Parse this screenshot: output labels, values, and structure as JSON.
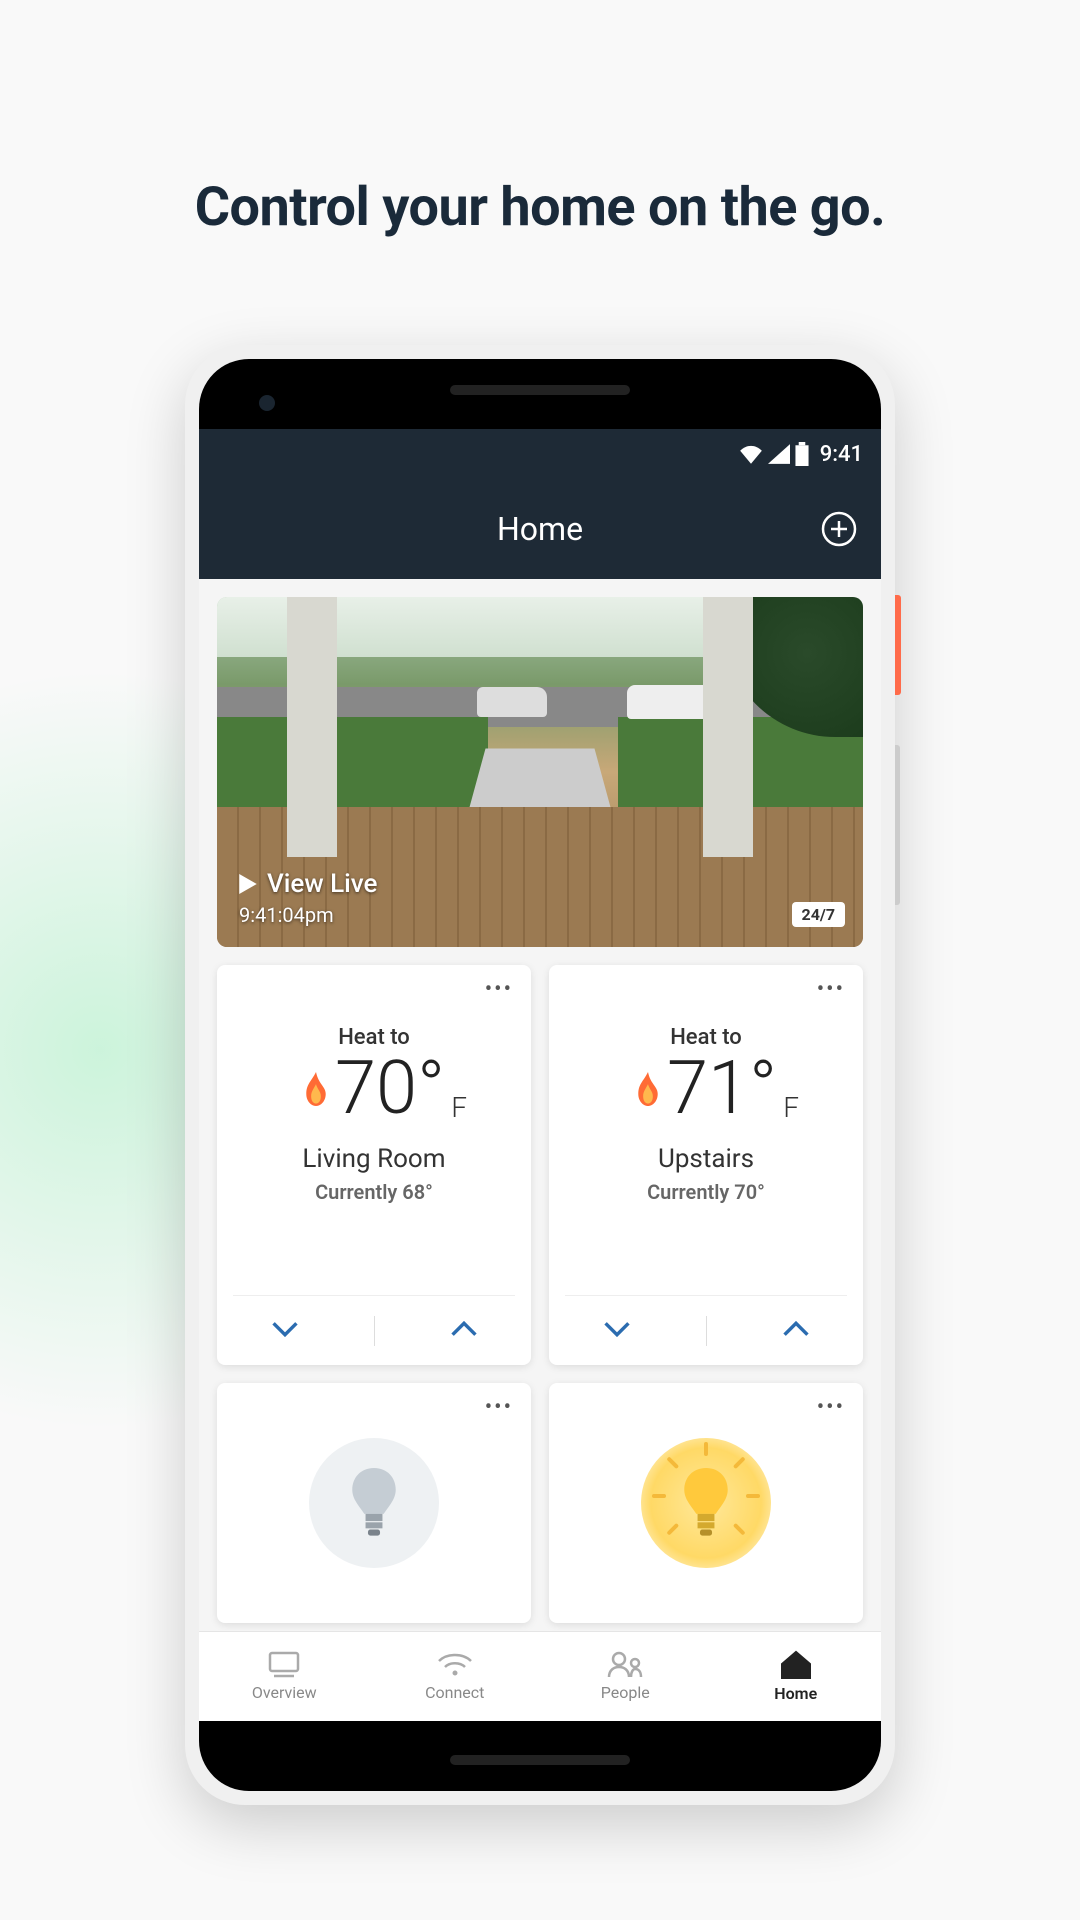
{
  "headline": "Control your home on the go.",
  "status": {
    "time": "9:41"
  },
  "header": {
    "title": "Home"
  },
  "camera": {
    "view_live": "View Live",
    "timestamp": "9:41:04pm",
    "badge": "24/7"
  },
  "thermostats": [
    {
      "mode_label": "Heat to",
      "target_temp": "70",
      "unit": "F",
      "room": "Living Room",
      "current_label": "Currently 68°"
    },
    {
      "mode_label": "Heat to",
      "target_temp": "71",
      "unit": "F",
      "room": "Upstairs",
      "current_label": "Currently 70°"
    }
  ],
  "lights": [
    {
      "state": "off"
    },
    {
      "state": "on"
    }
  ],
  "nav": {
    "overview": "Overview",
    "connect": "Connect",
    "people": "People",
    "home": "Home"
  }
}
